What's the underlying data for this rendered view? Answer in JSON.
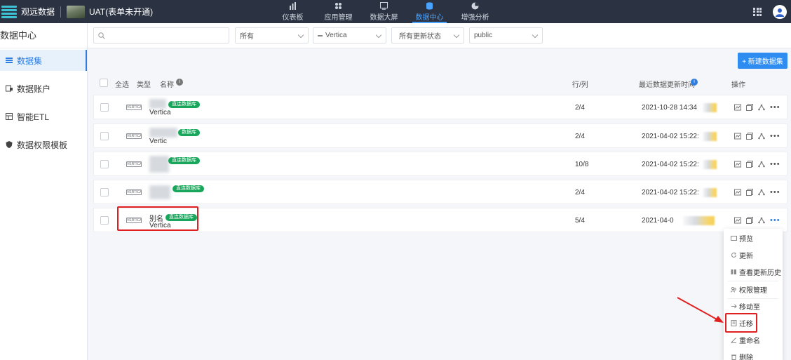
{
  "topbar": {
    "brand": "观远数据",
    "project": "UAT(表单未开通)",
    "nav": [
      {
        "label": "仪表板",
        "icon": "bar-chart-icon",
        "active": false
      },
      {
        "label": "应用管理",
        "icon": "apps-icon",
        "active": false
      },
      {
        "label": "数据大屏",
        "icon": "screen-icon",
        "active": false
      },
      {
        "label": "数据中心",
        "icon": "database-icon",
        "active": true
      },
      {
        "label": "增强分析",
        "icon": "analysis-icon",
        "active": false
      }
    ]
  },
  "sidebar": {
    "title": "数据中心",
    "items": [
      {
        "label": "数据集",
        "icon": "dataset-icon",
        "active": true
      },
      {
        "label": "数据账户",
        "icon": "account-icon",
        "active": false
      },
      {
        "label": "智能ETL",
        "icon": "etl-icon",
        "active": false
      },
      {
        "label": "数据权限模板",
        "icon": "shield-icon",
        "active": false
      }
    ]
  },
  "filters": {
    "search_placeholder": "",
    "type": "所有",
    "source": "Vertica",
    "status": "所有更新状态",
    "schema": "public"
  },
  "actions": {
    "new_dataset": "+ 新建数据集"
  },
  "table": {
    "headers": {
      "select_all": "全选",
      "type": "类型",
      "name": "名称",
      "rows_cols": "行/列",
      "last_update": "最近数据更新时间",
      "ops": "操作"
    },
    "rows": [
      {
        "name": "",
        "sub": "Vertica",
        "badge": "直连数据库",
        "rows_cols": "2/4",
        "time": "2021-10-28 14:34",
        "logo": "VERTICA"
      },
      {
        "name": "",
        "sub": "Vertic",
        "badge": "数据库",
        "rows_cols": "2/4",
        "time": "2021-04-02 15:22:",
        "logo": "VERTICA"
      },
      {
        "name": "",
        "sub": "",
        "badge": "直连数据库",
        "rows_cols": "10/8",
        "time": "2021-04-02 15:22:",
        "logo": "VERTICA"
      },
      {
        "name": "",
        "sub": "",
        "badge": "直连数据库",
        "rows_cols": "2/4",
        "time": "2021-04-02 15:22:",
        "logo": "VERTICA"
      },
      {
        "name": "别名",
        "sub": "Vertica",
        "badge": "直连数据库",
        "rows_cols": "5/4",
        "time": "2021-04-0",
        "logo": "VERTICA"
      }
    ]
  },
  "menu": {
    "items": [
      "预览",
      "更新",
      "查看更新历史",
      "权限管理",
      "移动至",
      "迁移",
      "重命名",
      "删除"
    ]
  },
  "colors": {
    "accent": "#2f8cf0",
    "badge": "#17a65a",
    "highlight": "#e02020",
    "topbar": "#2b3343"
  }
}
